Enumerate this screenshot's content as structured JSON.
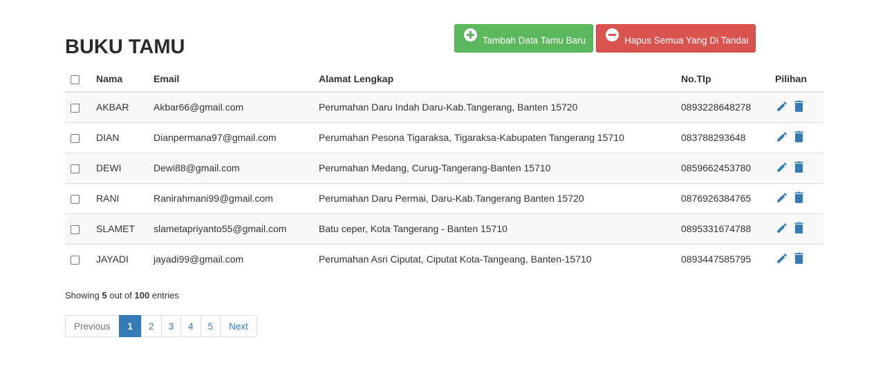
{
  "page": {
    "title": "BUKU TAMU"
  },
  "actions": {
    "add_label": "Tambah Data Tamu Baru",
    "delete_marked_label": "Hapus Semua Yang Di Tandai",
    "colors": {
      "add": "#5cb85c",
      "delete": "#d9534f",
      "icon": "#337ab7"
    }
  },
  "table": {
    "headers": {
      "nama": "Nama",
      "email": "Email",
      "alamat": "Alamat Lengkap",
      "tlp": "No.Tlp",
      "pilihan": "Pilihan"
    },
    "rows": [
      {
        "nama": "AKBAR",
        "email": "Akbar66@gmail.com",
        "alamat": "Perumahan Daru Indah Daru-Kab.Tangerang, Banten 15720",
        "tlp": "0893228648278"
      },
      {
        "nama": "DIAN",
        "email": "Dianpermana97@gmail.com",
        "alamat": "Perumahan Pesona Tigaraksa, Tigaraksa-Kabupaten Tangerang 15710",
        "tlp": "083788293648"
      },
      {
        "nama": "DEWI",
        "email": "Dewi88@gmail.com",
        "alamat": "Perumahan Medang, Curug-Tangerang-Banten 15710",
        "tlp": "0859662453780"
      },
      {
        "nama": "RANI",
        "email": "Ranirahmani99@gmail.com",
        "alamat": "Perumahan Daru Permai, Daru-Kab.Tangerang Banten 15720",
        "tlp": "0876926384765"
      },
      {
        "nama": "SLAMET",
        "email": "slametapriyanto55@gmail.com",
        "alamat": "Batu ceper, Kota Tangerang - Banten 15710",
        "tlp": "0895331674788"
      },
      {
        "nama": "JAYADI",
        "email": "jayadi99@gmail.com",
        "alamat": "Perumahan Asri Ciputat, Ciputat Kota-Tangeang, Banten-15710",
        "tlp": "0893447585795"
      }
    ],
    "row_icons": {
      "edit": "pencil-icon",
      "delete": "trash-icon"
    }
  },
  "summary": {
    "prefix": "Showing",
    "shown": "5",
    "middle": "out of",
    "total": "100",
    "suffix": "entries"
  },
  "pagination": {
    "previous": "Previous",
    "pages": [
      "1",
      "2",
      "3",
      "4",
      "5"
    ],
    "active_page": "1",
    "next": "Next"
  }
}
